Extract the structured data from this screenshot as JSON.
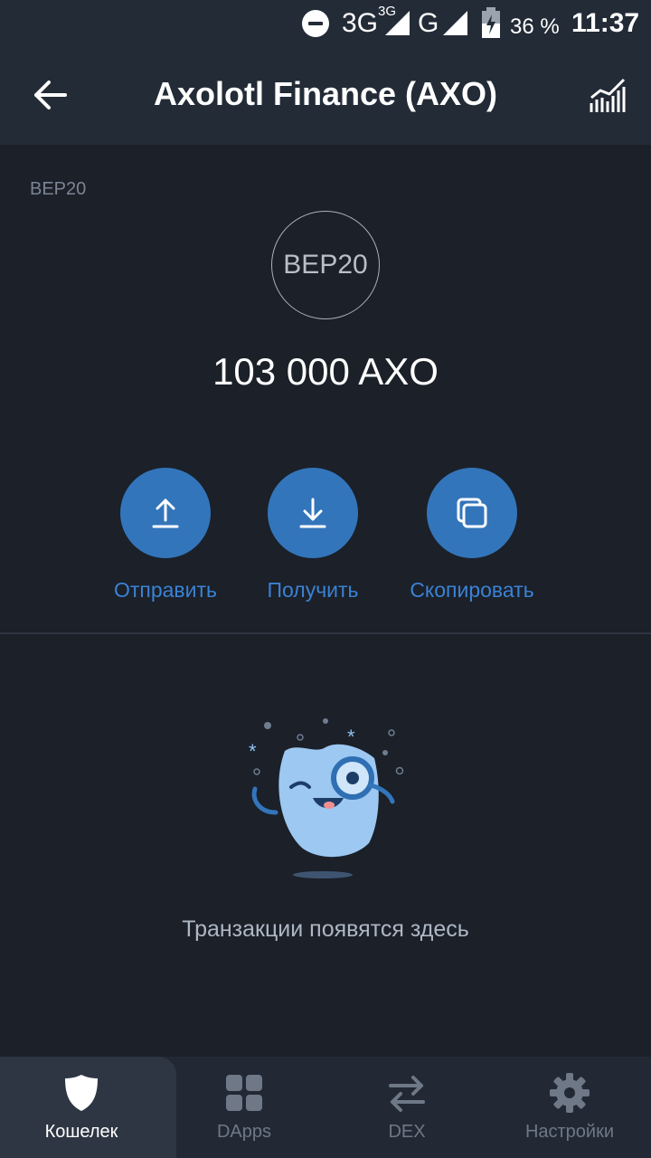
{
  "status_bar": {
    "network_1": "3G",
    "network_1_super": "3G",
    "network_2": "G",
    "battery": "36 %",
    "time": "11:37"
  },
  "header": {
    "title": "Axolotl Finance (AXO)",
    "back_icon": "arrow-left-icon",
    "chart_icon": "chart-icon"
  },
  "token": {
    "network_tag": "BEP20",
    "logo_text": "BEP20",
    "balance": "103 000 AXO"
  },
  "actions": [
    {
      "label": "Отправить",
      "icon": "upload-icon"
    },
    {
      "label": "Получить",
      "icon": "download-icon"
    },
    {
      "label": "Скопировать",
      "icon": "copy-icon"
    }
  ],
  "empty_state": {
    "text": "Транзакции появятся здесь",
    "illustration": "mascot-magnifier-illustration"
  },
  "tabs": [
    {
      "label": "Кошелек",
      "icon": "shield-icon",
      "active": true
    },
    {
      "label": "DApps",
      "icon": "grid-icon",
      "active": false
    },
    {
      "label": "DEX",
      "icon": "swap-icon",
      "active": false
    },
    {
      "label": "Настройки",
      "icon": "gear-icon",
      "active": false
    }
  ],
  "colors": {
    "background": "#1b2029",
    "appbar": "#232b37",
    "accent": "#3375bb",
    "accent_text": "#3b82d4"
  }
}
